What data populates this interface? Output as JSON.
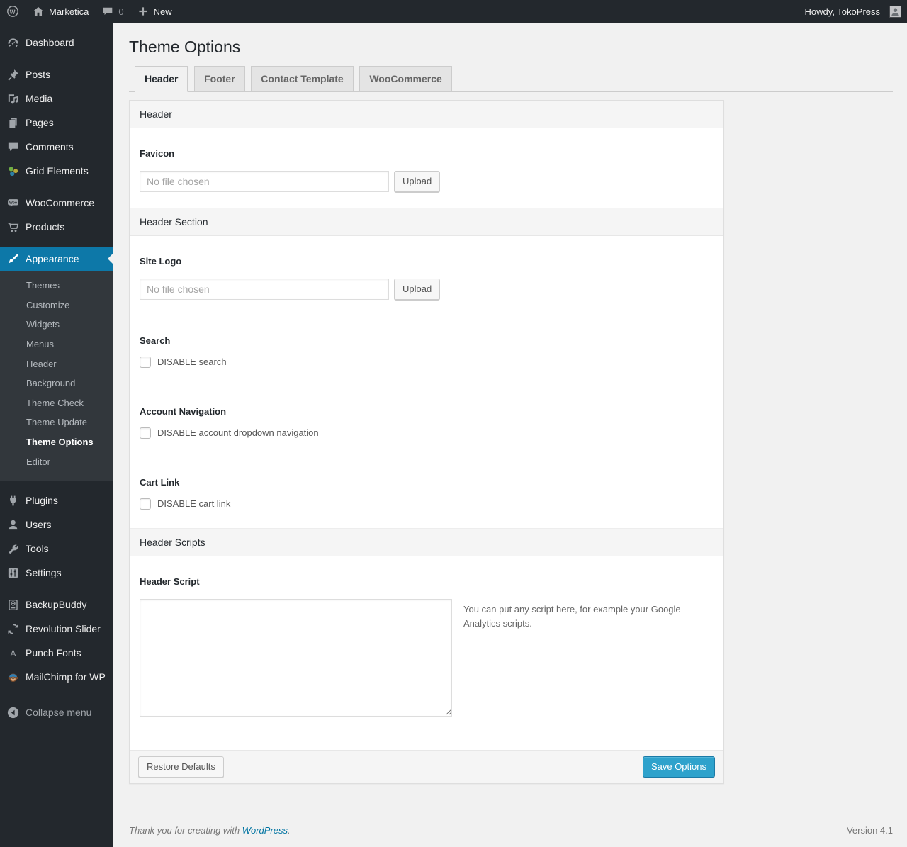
{
  "admin_bar": {
    "site_name": "Marketica",
    "comments_count": "0",
    "new_label": "New",
    "howdy_label": "Howdy, TokoPress"
  },
  "sidebar": {
    "items": [
      {
        "label": "Dashboard",
        "icon": "dashboard-icon"
      },
      {
        "label": "Posts",
        "icon": "pushpin-icon"
      },
      {
        "label": "Media",
        "icon": "media-icon"
      },
      {
        "label": "Pages",
        "icon": "pages-icon"
      },
      {
        "label": "Comments",
        "icon": "comments-icon"
      },
      {
        "label": "Grid Elements",
        "icon": "grid-elements-icon"
      },
      {
        "label": "WooCommerce",
        "icon": "woocommerce-icon"
      },
      {
        "label": "Products",
        "icon": "cart-icon"
      },
      {
        "label": "Appearance",
        "icon": "brush-icon",
        "active": true
      },
      {
        "label": "Plugins",
        "icon": "plugin-icon"
      },
      {
        "label": "Users",
        "icon": "user-icon"
      },
      {
        "label": "Tools",
        "icon": "wrench-icon"
      },
      {
        "label": "Settings",
        "icon": "settings-icon"
      },
      {
        "label": "BackupBuddy",
        "icon": "backup-drive-icon"
      },
      {
        "label": "Revolution Slider",
        "icon": "refresh-icon"
      },
      {
        "label": "Punch Fonts",
        "icon": "letter-a-icon"
      },
      {
        "label": "MailChimp for WP",
        "icon": "mailchimp-monkey-icon"
      },
      {
        "label": "Collapse menu",
        "icon": "collapse-arrow-icon"
      }
    ],
    "appearance_submenu": [
      "Themes",
      "Customize",
      "Widgets",
      "Menus",
      "Header",
      "Background",
      "Theme Check",
      "Theme Update",
      "Theme Options",
      "Editor"
    ],
    "current_submenu_item": "Theme Options"
  },
  "main": {
    "title": "Theme Options",
    "tabs": [
      "Header",
      "Footer",
      "Contact Template",
      "WooCommerce"
    ],
    "active_tab": "Header"
  },
  "panel": {
    "section_header_1": "Header",
    "section_header_2": "Header Section",
    "section_header_3": "Header Scripts",
    "favicon": {
      "label": "Favicon",
      "file_text": "No file chosen",
      "upload_label": "Upload"
    },
    "site_logo": {
      "label": "Site Logo",
      "file_text": "No file chosen",
      "upload_label": "Upload"
    },
    "search": {
      "label": "Search",
      "checkbox_label": "DISABLE search",
      "checked": false
    },
    "account_navigation": {
      "label": "Account Navigation",
      "checkbox_label": "DISABLE account dropdown navigation",
      "checked": false
    },
    "cart_link": {
      "label": "Cart Link",
      "checkbox_label": "DISABLE cart link",
      "checked": false
    },
    "header_script": {
      "label": "Header Script",
      "value": "",
      "help_text": "You can put any script here, for example your Google Analytics scripts."
    },
    "footer": {
      "restore_label": "Restore Defaults",
      "save_label": "Save Options"
    }
  },
  "page_footer": {
    "thanks_prefix": "Thank you for creating with ",
    "thanks_link": "WordPress",
    "thanks_suffix": ".",
    "version": "Version 4.1"
  },
  "colors": {
    "admin_bar_bg": "#23282d",
    "sidebar_bg": "#23282d",
    "submenu_bg": "#32373c",
    "menu_highlight": "#0d78a8",
    "primary_button": "#2ea2cc",
    "link_blue": "#0074a2",
    "page_bg": "#f1f1f1"
  }
}
